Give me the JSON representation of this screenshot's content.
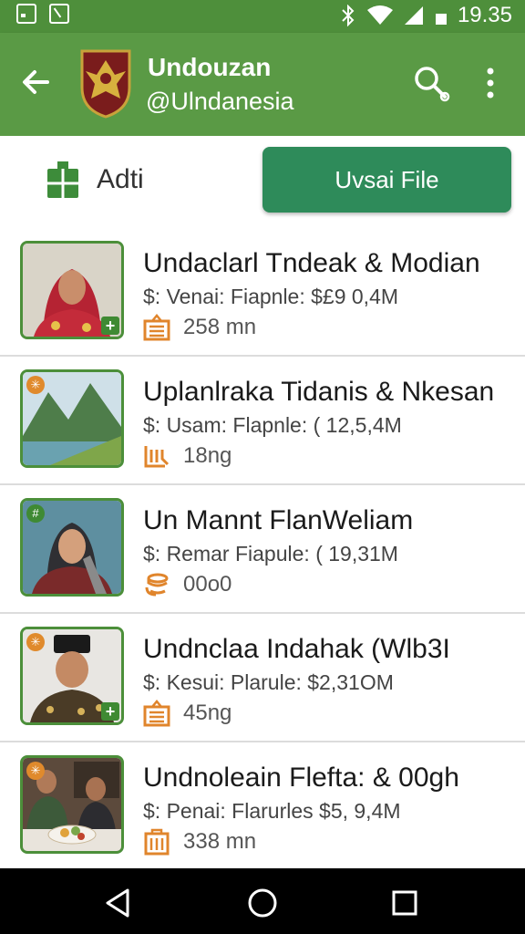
{
  "status_bar": {
    "time": "19.35",
    "icons": [
      "image-icon",
      "download-icon",
      "bluetooth-icon",
      "wifi-icon",
      "signal-icon",
      "battery-icon"
    ]
  },
  "app_bar": {
    "title": "Undouzan",
    "subtitle": "@Ulndanesia",
    "back_icon": "arrow-left-icon",
    "search_icon": "search-icon",
    "more_icon": "more-vert-icon"
  },
  "actions": {
    "add_label": "Adti",
    "upload_label": "Uvsai File"
  },
  "items": [
    {
      "title": "Undaclarl Tndeak & Modian",
      "meta": "$: Venai: Fiapnle:  $£9 0,4M",
      "stat": "258 mn",
      "thumb": "woman-hijab-red"
    },
    {
      "title": "Uplanlraka Tidanis & Nkesan",
      "meta": "$: Usam: Flapnle:  ( 12,5,4M",
      "stat": "18ng",
      "thumb": "mountain-lake"
    },
    {
      "title": "Un Mannt FlanWeliam",
      "meta": "$: Remar Fiapule:  ( 19,31M",
      "stat": "00o0",
      "thumb": "woman-hijab-grey"
    },
    {
      "title": "Undnclaa Indahak (Wlb3I",
      "meta": "$: Kesui: Plarule:  $2,31OM",
      "stat": "45ng",
      "thumb": "man-peci"
    },
    {
      "title": "Undnoleain Flefta: & 00gh",
      "meta": "$: Penai: Flarurles  $5, 9,4M",
      "stat": "338 mn",
      "thumb": "food-table"
    }
  ],
  "colors": {
    "app_bar": "#5a9a45",
    "status_bar": "#4e8f3b",
    "upload_button": "#2e8b5a",
    "stat_icon": "#e0852c"
  }
}
